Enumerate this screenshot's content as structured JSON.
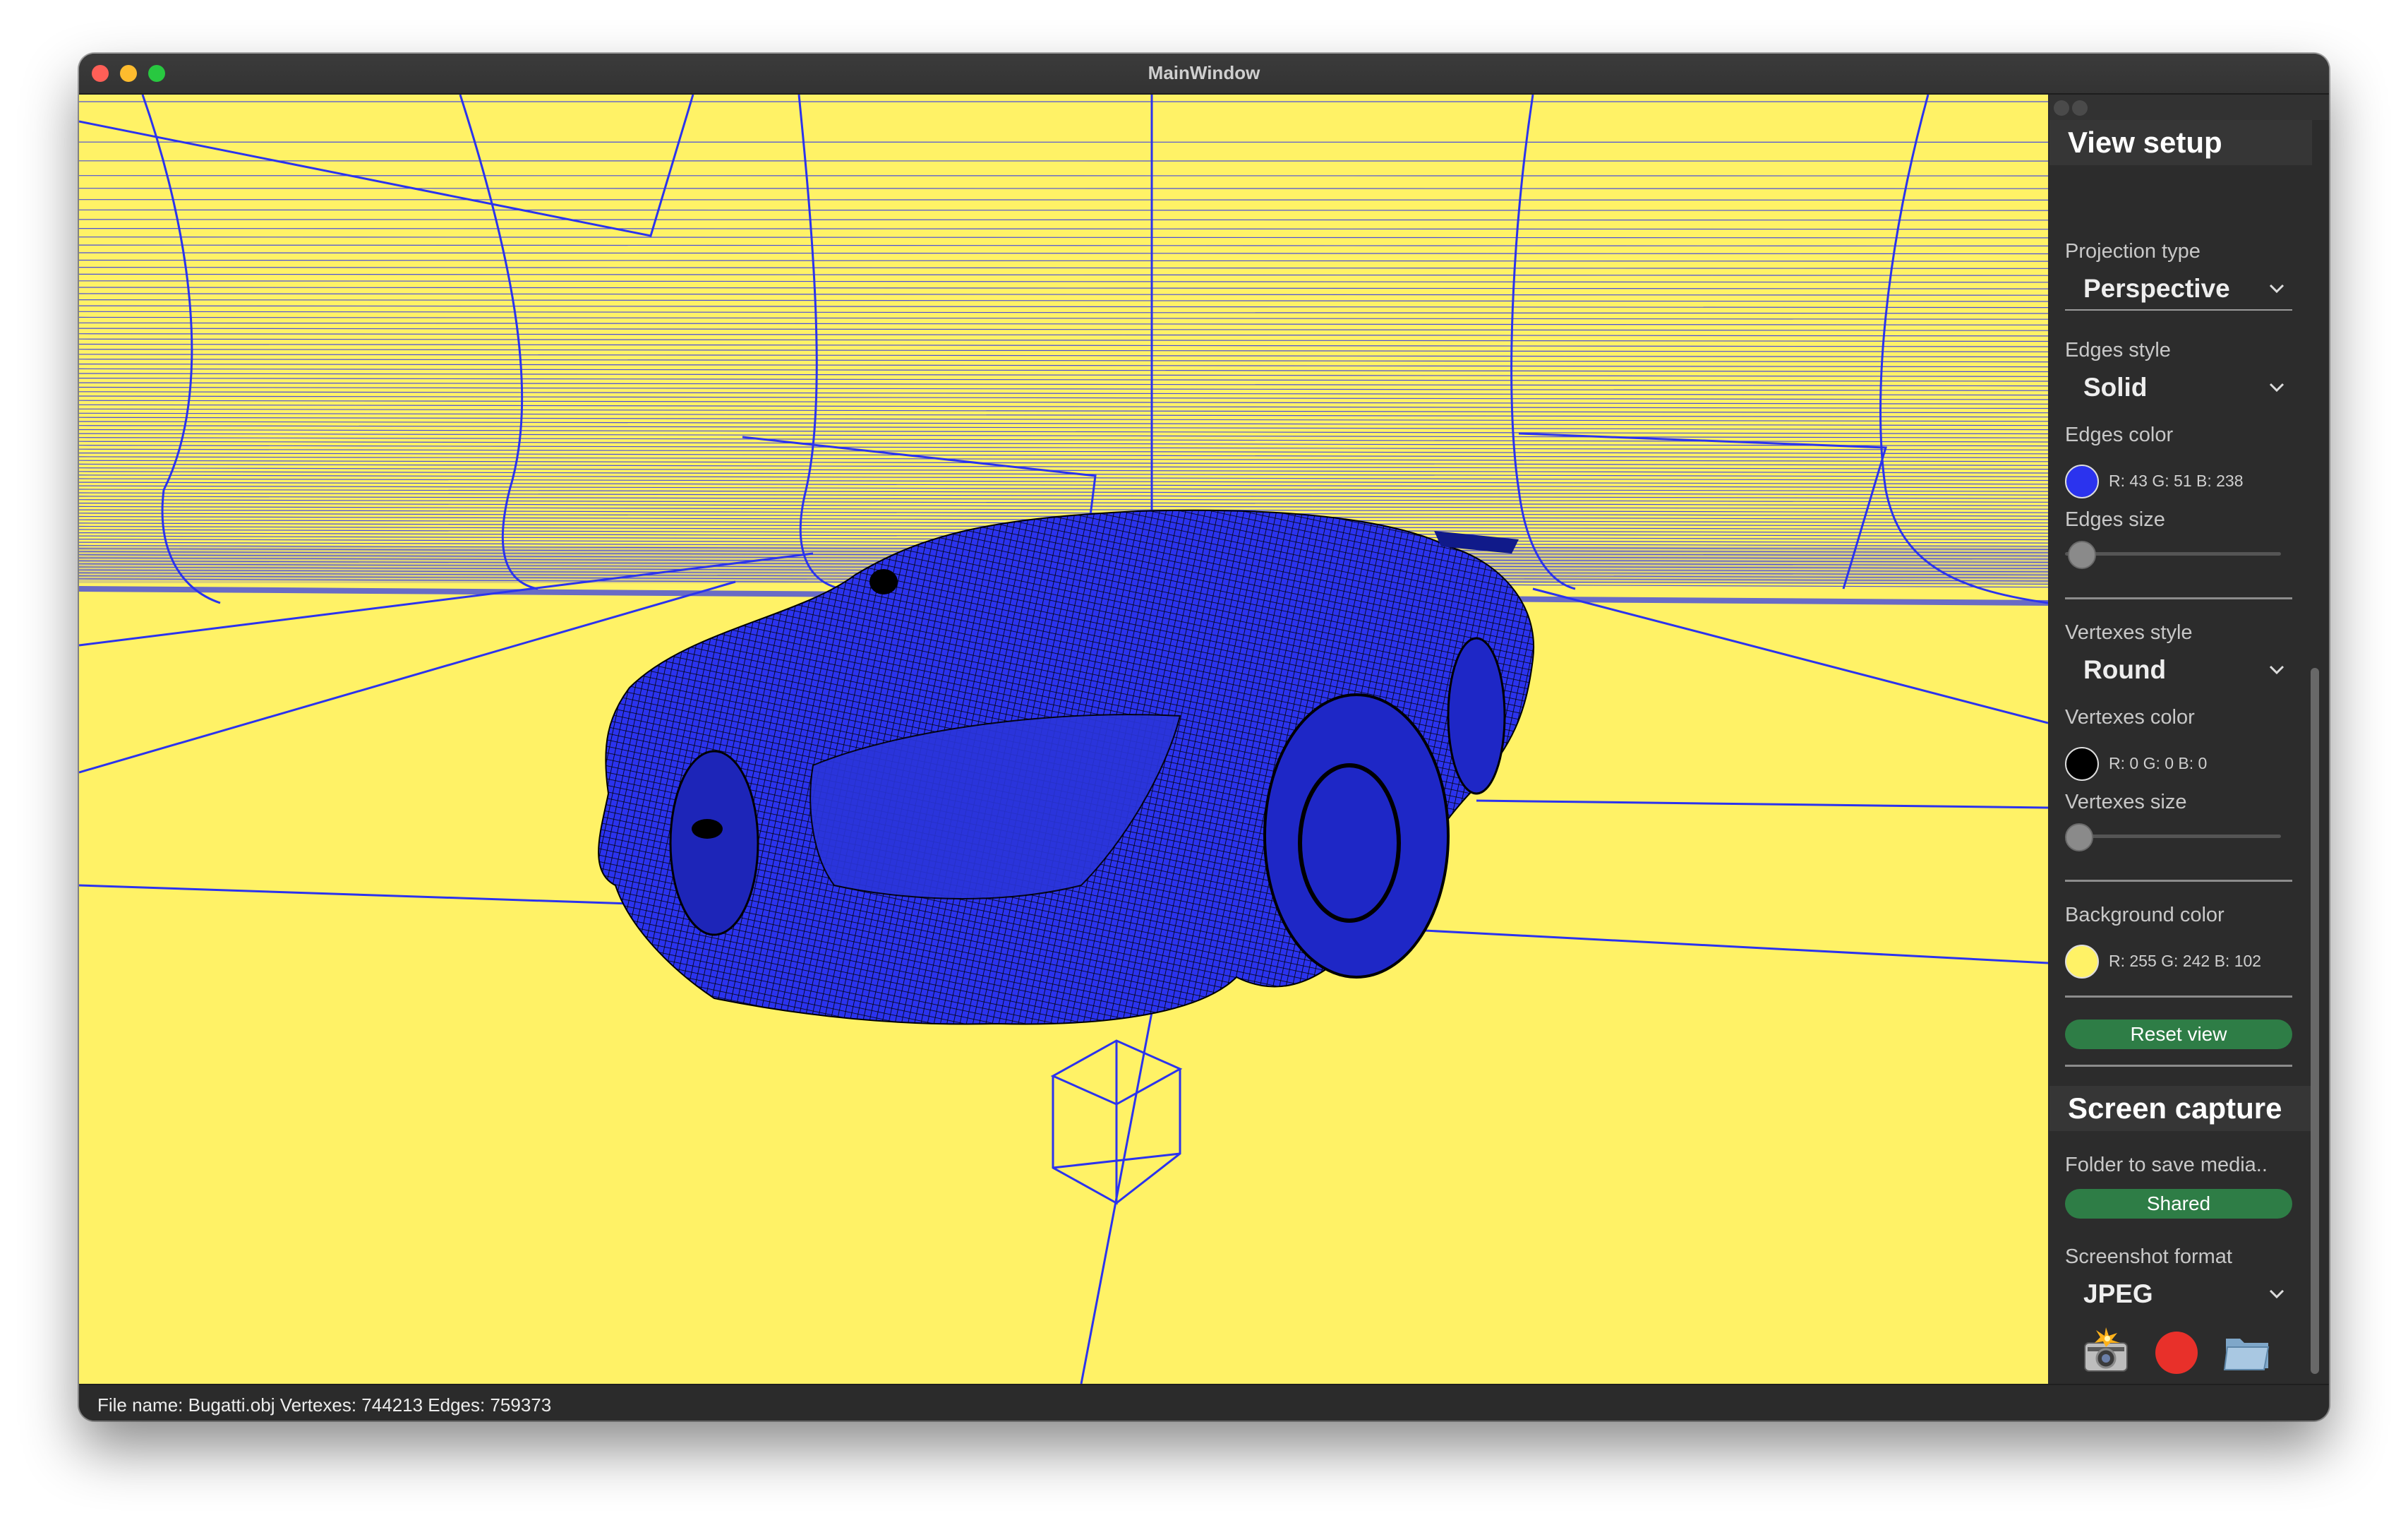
{
  "window": {
    "title": "MainWindow"
  },
  "view_setup": {
    "heading": "View setup",
    "projection_type": {
      "label": "Projection type",
      "value": "Perspective"
    },
    "edges_style": {
      "label": "Edges style",
      "value": "Solid"
    },
    "edges_color": {
      "label": "Edges color",
      "rgb_text": "R: 43 G: 51 B: 238",
      "hex": "#2b33ee"
    },
    "edges_size": {
      "label": "Edges size",
      "level": 0.05
    },
    "vertexes_style": {
      "label": "Vertexes style",
      "value": "Round"
    },
    "vertexes_color": {
      "label": "Vertexes color",
      "rgb_text": "R: 0 G: 0 B: 0",
      "hex": "#000000"
    },
    "vertexes_size": {
      "label": "Vertexes size",
      "level": 0.0
    },
    "background_color": {
      "label": "Background color",
      "rgb_text": "R: 255 G: 242 B: 102",
      "hex": "#fff266"
    },
    "reset_view_label": "Reset view"
  },
  "screen_capture": {
    "heading": "Screen capture",
    "folder_label": "Folder to save media..",
    "folder_value": "Shared",
    "screenshot_format": {
      "label": "Screenshot format",
      "value": "JPEG"
    },
    "actions": {
      "screenshot_icon": "camera-flash-icon",
      "record_icon": "record-icon",
      "open_folder_icon": "folder-icon"
    }
  },
  "status_bar": {
    "text": "File name: Bugatti.obj  Vertexes: 744213  Edges: 759373"
  },
  "colors": {
    "accent_green": "#2e7d46",
    "record_red": "#e8302a"
  }
}
